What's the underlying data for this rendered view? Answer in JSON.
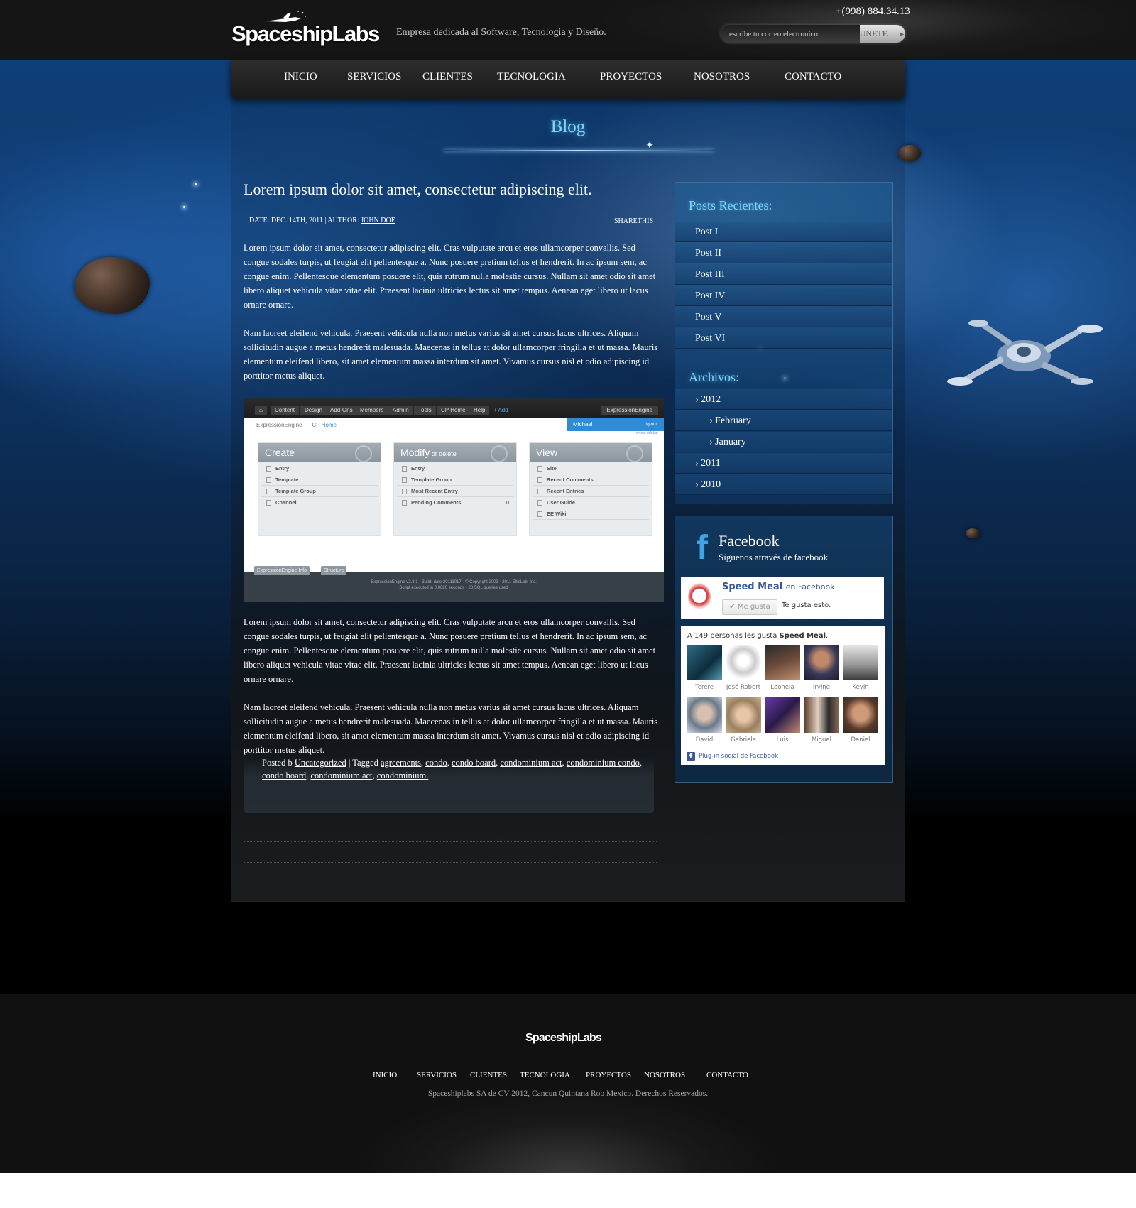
{
  "header": {
    "logo_text": "SpaceshipLabs",
    "tagline": "Empresa dedicada al Software, Tecnologia y Diseño.",
    "phone": "+(998) 884.34.13",
    "subscribe": {
      "placeholder": "escribe tu correo electronico",
      "button": "UNETE"
    }
  },
  "nav": [
    "INICIO",
    "SERVICIOS",
    "CLIENTES",
    "TECNOLOGIA",
    "PROYECTOS",
    "NOSOTROS",
    "CONTACTO"
  ],
  "page_title": "Blog",
  "post": {
    "title": "Lorem ipsum dolor sit amet, consectetur adipiscing elit.",
    "date_label": "DATE: DEC. 14TH, 2011",
    "author_label": "| AUTHOR: ",
    "author": "JOHN DOE",
    "share": "SHARETHIS",
    "paragraphs": [
      "Lorem ipsum dolor sit amet, consectetur adipiscing elit. Cras vulputate arcu et eros ullamcorper convallis. Sed congue sodales turpis, ut feugiat elit pellentesque a. Nunc posuere pretium tellus et hendrerit. In ac ipsum sem, ac congue enim. Pellentesque elementum posuere elit, quis rutrum nulla molestie cursus. Nullam sit amet odio sit amet libero aliquet vehicula vitae vitae elit. Praesent lacinia ultricies lectus sit amet tempus. Aenean eget libero ut lacus ornare ornare.",
      "Nam laoreet eleifend vehicula. Praesent vehicula nulla non metus varius sit amet cursus lacus ultrices. Aliquam sollicitudin augue a metus hendrerit malesuada. Maecenas in tellus at dolor ullamcorper fringilla et ut massa. Mauris elementum eleifend libero, sit amet elementum massa interdum sit amet. Vivamus cursus nisl et odio adipiscing id porttitor metus aliquet.",
      "Lorem ipsum dolor sit amet, consectetur adipiscing elit. Cras vulputate arcu et eros ullamcorper convallis. Sed congue sodales turpis, ut feugiat elit pellentesque a. Nunc posuere pretium tellus et hendrerit. In ac ipsum sem, ac congue enim. Pellentesque elementum posuere elit, quis rutrum nulla molestie cursus. Nullam sit amet odio sit amet libero aliquet vehicula vitae vitae elit. Praesent lacinia ultricies lectus sit amet tempus. Aenean eget libero ut lacus ornare ornare.",
      "Nam laoreet eleifend vehicula. Praesent vehicula nulla non metus varius sit amet cursus lacus ultrices. Aliquam sollicitudin augue a metus hendrerit malesuada. Maecenas in tellus at dolor ullamcorper fringilla et ut massa. Mauris elementum eleifend libero, sit amet elementum massa interdum sit amet. Vivamus cursus nisl et odio adipiscing id porttitor metus aliquet."
    ],
    "footer": {
      "posted_prefix": "Posted b ",
      "category": "Uncategorized",
      "tagged_prefix": " | Tagged ",
      "tags": [
        "agreements",
        "condo",
        "condo board",
        "condominium act",
        "condominium condo",
        "condo board",
        "condominium act",
        "condominium. "
      ]
    }
  },
  "embedded_screenshot": {
    "tabs": [
      "Content",
      "Design",
      "Add-Ons",
      "Members",
      "Admin",
      "Tools",
      "CP Home",
      "Help"
    ],
    "add": "+ Add",
    "brand": "ExpressionEngine",
    "breadcrumb_root": "ExpressionEngine",
    "breadcrumb_current": "CP Home",
    "user": "Michael",
    "logout": "Log-out",
    "reveal_sidebar": "reveal sidebar",
    "boxes": [
      {
        "title": "Create",
        "subtitle": "",
        "items": [
          "Entry",
          "Template",
          "Template Group",
          "Channel"
        ]
      },
      {
        "title": "Modify",
        "subtitle": " or delete",
        "items": [
          "Entry",
          "Template Group",
          "Most Recent Entry",
          "Pending Comments"
        ],
        "pending_count": "0"
      },
      {
        "title": "View",
        "subtitle": "",
        "items": [
          "Site",
          "Recent Comments",
          "Recent Entries",
          "User Guide",
          "EE Wiki"
        ]
      }
    ],
    "footer_tabs": [
      "ExpressionEngine Info",
      "Structure"
    ],
    "copyright_1": "ExpressionEngine v2.3.1 - Build: date 20111017 - © Copyright 2003 - 2011 EllisLab, Inc.",
    "copyright_2": "Script executed in 0.0820 seconds - 28 SQL queries used"
  },
  "sidebar": {
    "recent_title": "Posts Recientes:",
    "recent_posts": [
      "Post I",
      "Post II",
      "Post III",
      "Post IV",
      "Post V",
      "Post VI"
    ],
    "archives_title": "Archivos:",
    "archives": [
      {
        "label": "› 2012",
        "level": 0
      },
      {
        "label": "› February",
        "level": 1
      },
      {
        "label": "› January",
        "level": 1
      },
      {
        "label": "› 2011",
        "level": 0
      },
      {
        "label": "› 2010",
        "level": 0
      }
    ]
  },
  "facebook": {
    "title": "Facebook",
    "subtitle": "Síguenos através de facebook",
    "page_name": "Speed Meal",
    "on_facebook": "en Facebook",
    "like_button": "Me gusta",
    "likes_this": "Te gusta esto.",
    "count_prefix": "A 149 personas les gusta ",
    "count_page": "Speed Meal",
    "count_suffix": ".",
    "faces": [
      "Terere",
      "José Robert",
      "Leonela",
      "Irving",
      "Kévin",
      "David",
      "Gabriela",
      "Luis",
      "Miguel",
      "Daniel"
    ],
    "plugin_label": "Plug-in social de Facebook"
  },
  "footer": {
    "logo_text": "SpaceshipLabs",
    "nav": [
      "INICIO",
      "SERVICIOS",
      "CLIENTES",
      "TECNOLOGIA",
      "PROYECTOS",
      "NOSOTROS",
      "CONTACTO"
    ],
    "copyright": "Spaceshiplabs SA de CV 2012, Cancun Quintana Roo Mexico. Derechos Reservados."
  },
  "colors": {
    "accent": "#7fd6f5",
    "facebook_blue": "#3b5998",
    "background": "#000000"
  }
}
